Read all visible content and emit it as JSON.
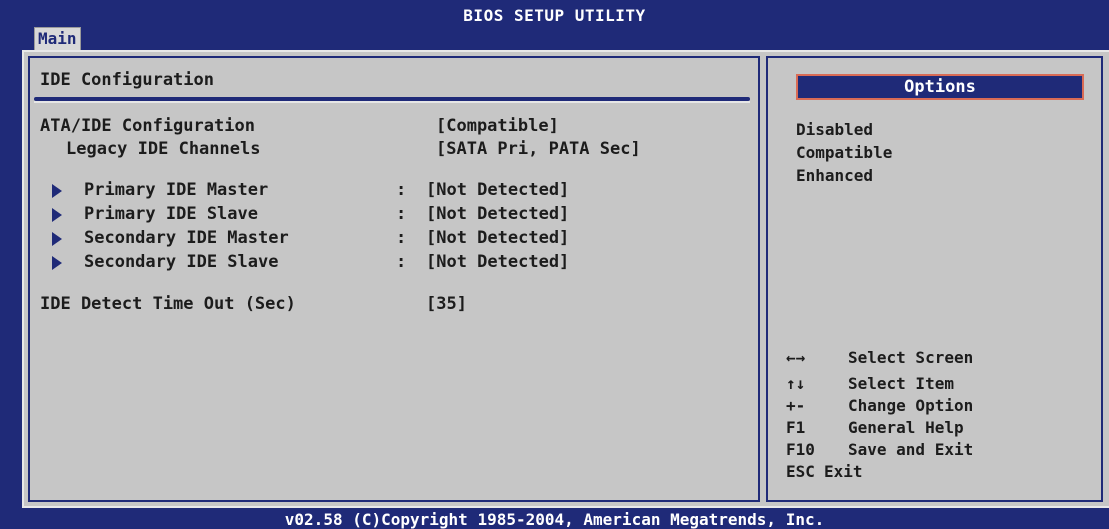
{
  "header": {
    "title": "BIOS SETUP UTILITY",
    "active_tab": "Main"
  },
  "section": {
    "title": "IDE Configuration"
  },
  "settings": [
    {
      "label": "ATA/IDE Configuration",
      "value": "[Compatible]"
    },
    {
      "label": "Legacy IDE Channels",
      "value": "[SATA Pri, PATA Sec]"
    }
  ],
  "submenus": [
    {
      "label": "Primary IDE Master",
      "sep": ":",
      "value": "[Not Detected]"
    },
    {
      "label": "Primary IDE Slave",
      "sep": ":",
      "value": "[Not Detected]"
    },
    {
      "label": "Secondary IDE Master",
      "sep": ":",
      "value": "[Not Detected]"
    },
    {
      "label": "Secondary IDE Slave",
      "sep": ":",
      "value": "[Not Detected]"
    }
  ],
  "timeout": {
    "label": "IDE Detect Time Out (Sec)",
    "value": "[35]"
  },
  "options_panel": {
    "header": "Options",
    "items": [
      "Disabled",
      "Compatible",
      "Enhanced"
    ]
  },
  "help": [
    {
      "key": "←→",
      "desc": "Select Screen",
      "icon": "left-right-arrow-icon"
    },
    {
      "key": "↑↓",
      "desc": "Select Item",
      "icon": "up-down-arrow-icon"
    },
    {
      "key": "+-",
      "desc": "Change Option"
    },
    {
      "key": "F1",
      "desc": "General Help"
    },
    {
      "key": "F10",
      "desc": "Save and Exit"
    },
    {
      "key": "ESC",
      "desc": "Exit"
    }
  ],
  "footer": {
    "text": "v02.58 (C)Copyright 1985-2004, American Megatrends, Inc."
  },
  "colors": {
    "bios_blue": "#1f2a78",
    "panel_gray": "#c6c6c6",
    "options_border": "#d96b55"
  }
}
